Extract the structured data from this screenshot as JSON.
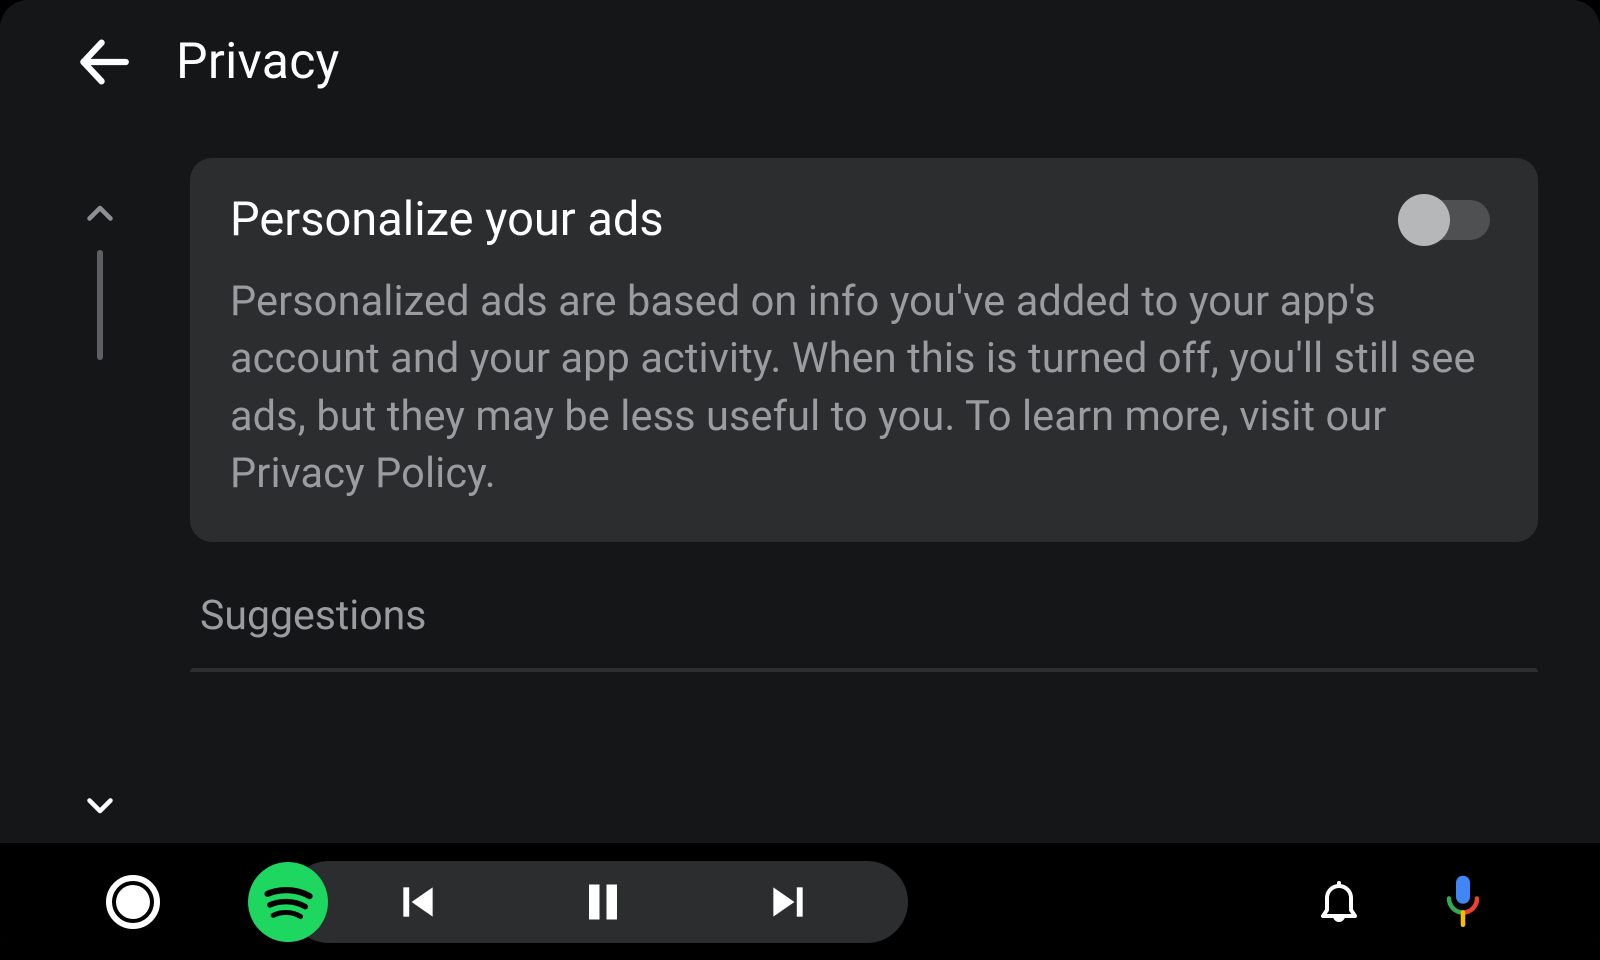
{
  "header": {
    "title": "Privacy"
  },
  "settings": {
    "personalizeAds": {
      "title": "Personalize your ads",
      "description": "Personalized ads are based on info you've added to your app's account and your app activity. When this is turned off, you'll still see ads, but they may be less useful to you. To learn more, visit our Privacy Policy.",
      "enabled": false
    }
  },
  "sections": {
    "suggestionsLabel": "Suggestions"
  },
  "icons": {
    "back": "arrow-left",
    "scrollUp": "chevron-up",
    "scrollDown": "chevron-down",
    "home": "radio-circle",
    "mediaApp": "spotify",
    "previous": "skip-previous",
    "playPause": "pause",
    "next": "skip-next",
    "notifications": "bell",
    "voice": "google-mic"
  }
}
